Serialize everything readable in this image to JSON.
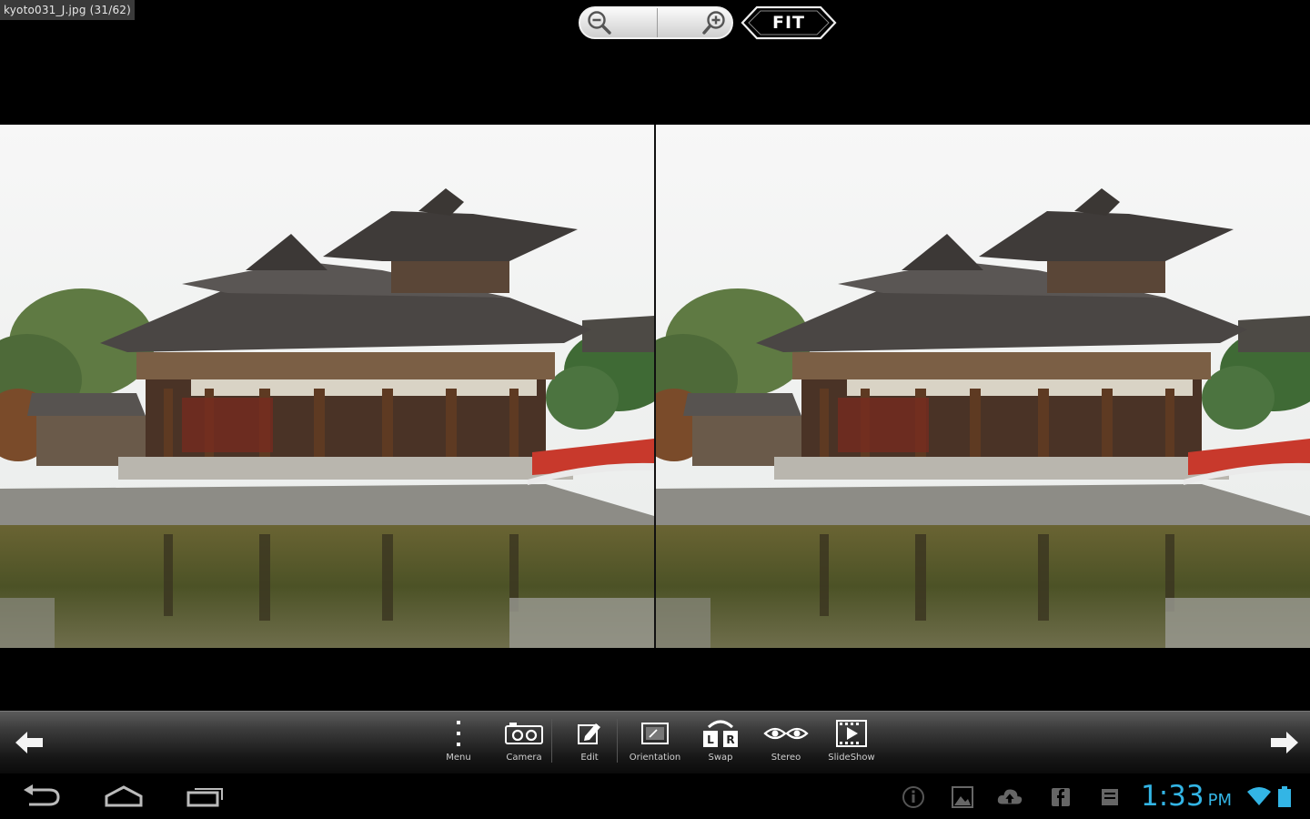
{
  "file_label": "kyoto031_J.jpg (31/62)",
  "zoom": {
    "out_icon": "zoom-out-icon",
    "in_icon": "zoom-in-icon"
  },
  "fit_label": "FIT",
  "photo": {
    "left_eye": "temple-photo-left",
    "right_eye": "temple-photo-right"
  },
  "toolbar": {
    "prev_icon": "arrow-left-icon",
    "next_icon": "arrow-right-icon",
    "items": [
      {
        "label": "Menu",
        "icon": "menu-dots-icon"
      },
      {
        "label": "Camera",
        "icon": "stereo-camera-icon"
      },
      {
        "label": "Edit",
        "icon": "edit-icon"
      },
      {
        "label": "Orientation",
        "icon": "orientation-icon"
      },
      {
        "label": "Swap",
        "icon": "swap-lr-icon"
      },
      {
        "label": "Stereo",
        "icon": "stereo-eyes-icon"
      },
      {
        "label": "SlideShow",
        "icon": "slideshow-icon"
      }
    ]
  },
  "system": {
    "clock": "1:33",
    "ampm": "PM",
    "accent_color": "#33b5e5",
    "nav_icons": [
      "back-icon",
      "home-icon",
      "recent-apps-icon"
    ],
    "notification_icons": [
      "info-icon",
      "gallery-icon",
      "cloud-upload-icon",
      "facebook-icon",
      "storage-icon"
    ],
    "status_icons": [
      "wifi-icon",
      "battery-icon"
    ]
  }
}
